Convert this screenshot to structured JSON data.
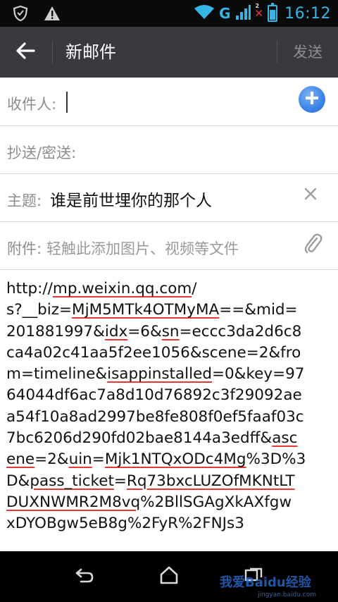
{
  "status_bar": {
    "time": "16:12",
    "network": "G",
    "sim_badge": "2",
    "battery_level": 0.7,
    "icons": [
      "shield-icon",
      "warning-icon",
      "wifi-icon",
      "signal-icon",
      "no-signal-icon",
      "battery-icon"
    ]
  },
  "action_bar": {
    "title": "新邮件",
    "send_label": "发送",
    "back_icon": "back-arrow-icon"
  },
  "form": {
    "to_label": "收件人:",
    "cc_label": "抄送/密送:",
    "subject_label": "主题:",
    "subject_value": "谁是前世埋你的那个人",
    "attachment_label": "附件:",
    "attachment_placeholder": "轻触此添加图片、视频等文件"
  },
  "body": {
    "lines": [
      [
        {
          "t": "http://"
        },
        {
          "t": "mp.weixin.qq.com",
          "u": true
        },
        {
          "t": "/"
        }
      ],
      [
        {
          "t": "s?__biz="
        },
        {
          "t": "MjM5MTk4OTMyMA",
          "u": true
        },
        {
          "t": "==&mid="
        }
      ],
      [
        {
          "t": "201881997&"
        },
        {
          "t": "idx",
          "u": true
        },
        {
          "t": "=6&"
        },
        {
          "t": "sn",
          "u": true
        },
        {
          "t": "=eccc3da2d6c8"
        }
      ],
      [
        {
          "t": "ca4a02c41aa5f2ee1056&scene=2&fro"
        }
      ],
      [
        {
          "t": "m=timeline&"
        },
        {
          "t": "isappinstalled",
          "u": true
        },
        {
          "t": "=0&key=97"
        }
      ],
      [
        {
          "t": "64044df6ac7a8d10d76892c3f29092ae"
        }
      ],
      [
        {
          "t": "a54f10a8ad2997be8fe808f0ef5faaf03c"
        }
      ],
      [
        {
          "t": "7bc6206d290fd02bae8144a3edff&"
        },
        {
          "t": "asc",
          "u": true
        }
      ],
      [
        {
          "t": "ene",
          "u": true
        },
        {
          "t": "=2&"
        },
        {
          "t": "uin",
          "u": true
        },
        {
          "t": "="
        },
        {
          "t": "Mjk1NTQxODc4Mg",
          "u": true
        },
        {
          "t": "%3D%3"
        }
      ],
      [
        {
          "t": "D&"
        },
        {
          "t": "pass_ticket",
          "u": true
        },
        {
          "t": "="
        },
        {
          "t": "Rq73bxcLUZOfMKNtLT",
          "u": true
        }
      ],
      [
        {
          "t": "DUXNWMR2M8vq",
          "u": true
        },
        {
          "t": "%2BllSGAgXkAXfgw"
        }
      ],
      [
        {
          "t": "xDYOBgw5eB8g%2FyR%2FNJs3"
        }
      ]
    ]
  },
  "nav_bar": {
    "icons": [
      "back-icon",
      "home-icon",
      "recent-apps-icon"
    ],
    "watermark_text": "我爱Baidu经验",
    "watermark_url": "jingyan.baidu.com"
  },
  "colors": {
    "status_accent": "#34b5e5",
    "action_bar_bg": "#393a3f",
    "add_button": "#3f86e8",
    "spellcheck_underline": "#e53935"
  }
}
